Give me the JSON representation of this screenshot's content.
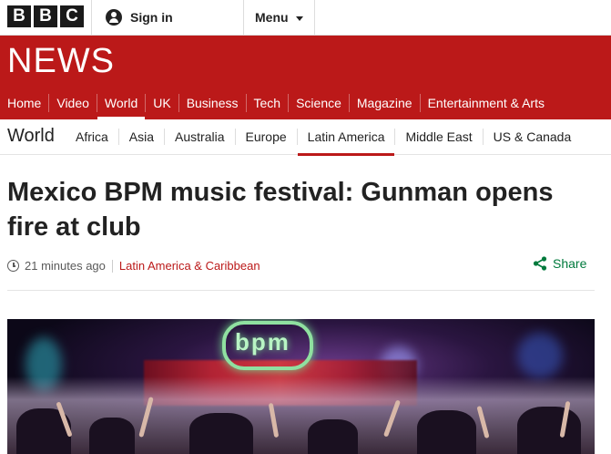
{
  "header": {
    "logo_letters": [
      "B",
      "B",
      "C"
    ],
    "signin_label": "Sign in",
    "menu_label": "Menu"
  },
  "banner": {
    "title": "NEWS",
    "color": "#bb1919"
  },
  "nav": {
    "items": [
      {
        "label": "Home"
      },
      {
        "label": "Video"
      },
      {
        "label": "World",
        "active": true
      },
      {
        "label": "UK"
      },
      {
        "label": "Business"
      },
      {
        "label": "Tech"
      },
      {
        "label": "Science"
      },
      {
        "label": "Magazine"
      },
      {
        "label": "Entertainment & Arts"
      }
    ]
  },
  "subnav": {
    "section_title": "World",
    "items": [
      {
        "label": "Africa"
      },
      {
        "label": "Asia"
      },
      {
        "label": "Australia"
      },
      {
        "label": "Europe"
      },
      {
        "label": "Latin America",
        "active": true
      },
      {
        "label": "Middle East"
      },
      {
        "label": "US & Canada"
      }
    ]
  },
  "article": {
    "headline": "Mexico BPM music festival: Gunman opens fire at club",
    "time": "21 minutes ago",
    "category": "Latin America & Caribbean",
    "share_label": "Share",
    "image_sign_text": "bpm"
  },
  "icons": {
    "signin": "user-icon",
    "menu": "chevron-down-icon",
    "time": "clock-icon",
    "share": "share-icon"
  }
}
